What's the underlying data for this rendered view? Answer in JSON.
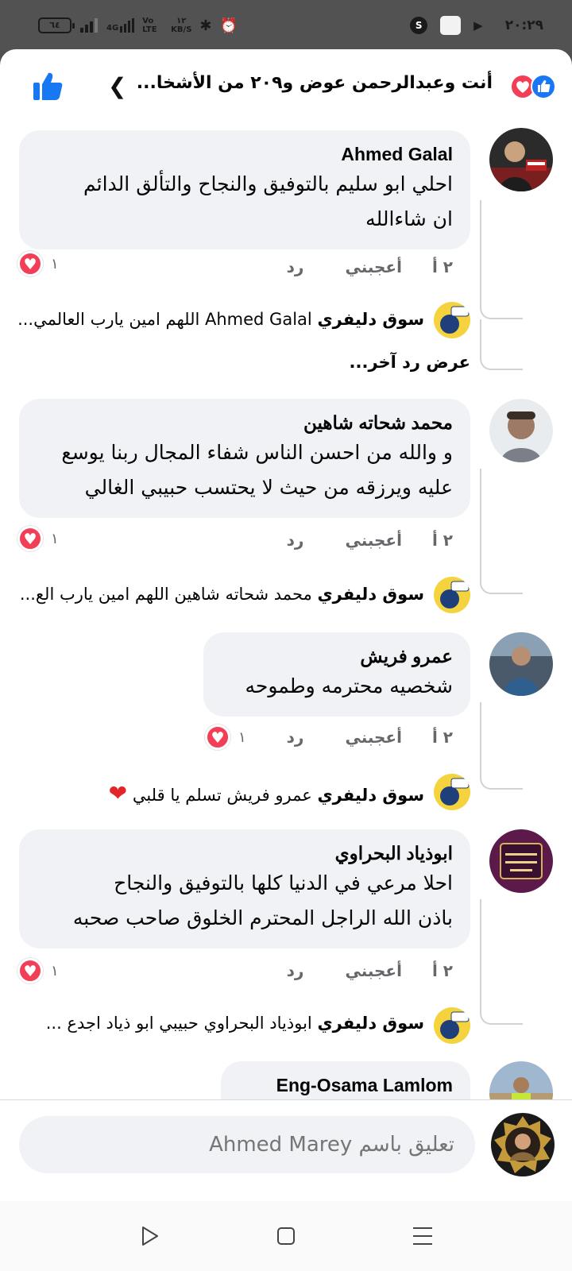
{
  "status_bar": {
    "battery": "٦٤",
    "network": "4G",
    "volte": "Vo LTE",
    "speed_value": "١٢",
    "speed_unit": "KB/S",
    "time": "٢٠:٢٩"
  },
  "header": {
    "title": "أنت وعبدالرحمن عوض و٢٠٩ من الأشخا..."
  },
  "comments": [
    {
      "author": "Ahmed Galal",
      "text_lines": [
        "احلي ابو سليم بالتوفيق والنجاح والتألق الدائم",
        "ان شاءالله"
      ],
      "time": "٢ أ",
      "like_label": "أعجبني",
      "reply_label": "رد",
      "reaction_count": "١",
      "reply": {
        "author": "سوق دليفري",
        "text": "Ahmed Galal اللهم امين يارب العالمي..."
      },
      "more_replies": "عرض رد آخر..."
    },
    {
      "author": "محمد شحاته شاهين",
      "text_lines": [
        "و والله من احسن الناس شفاء المجال ربنا يوسع",
        "عليه ويرزقه من حيث لا يحتسب حبيبي الغالي"
      ],
      "time": "٢ أ",
      "like_label": "أعجبني",
      "reply_label": "رد",
      "reaction_count": "١",
      "reply": {
        "author": "سوق دليفري",
        "text": "محمد شحاته شاهين اللهم امين يارب الع..."
      }
    },
    {
      "author": "عمرو فريش",
      "text_lines": [
        "شخصيه محترمه وطموحه"
      ],
      "time": "٢ أ",
      "like_label": "أعجبني",
      "reply_label": "رد",
      "reaction_count": "١",
      "reply": {
        "author": "سوق دليفري",
        "text": "عمرو فريش تسلم يا قلبي",
        "emoji": "❤"
      }
    },
    {
      "author": "ابوذياد البحراوي",
      "text_lines": [
        "احلا مرعي في الدنيا كلها بالتوفيق والنجاح",
        "باذن الله الراجل المحترم الخلوق صاحب صحبه"
      ],
      "time": "٢ أ",
      "like_label": "أعجبني",
      "reply_label": "رد",
      "reaction_count": "١",
      "reply": {
        "author": "سوق دليفري",
        "text": "ابوذياد البحراوي حبيبي ابو ذياد اجدع ..."
      }
    },
    {
      "author": "Eng-Osama Lamlom"
    }
  ],
  "composer": {
    "placeholder": "تعليق باسم Ahmed Marey"
  },
  "colors": {
    "facebook_blue": "#1877f2",
    "love_red": "#f33e58",
    "bubble_gray": "#f0f2f5",
    "meta_text": "#65676b"
  }
}
